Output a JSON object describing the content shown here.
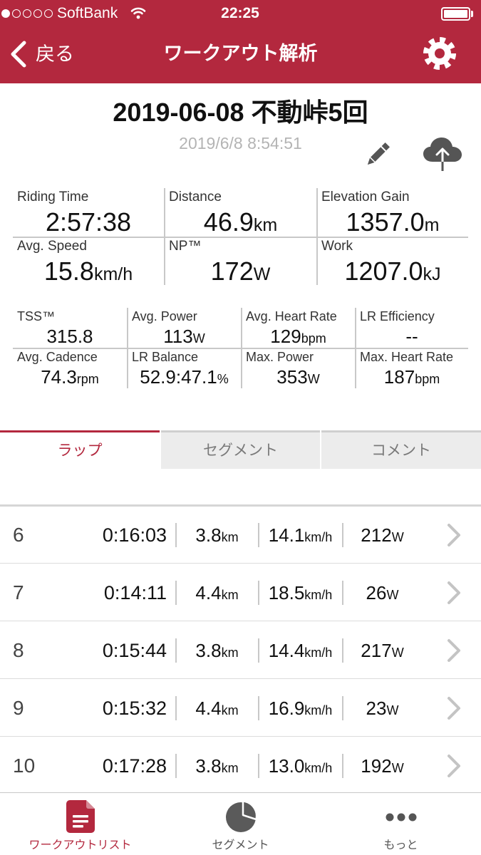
{
  "colors": {
    "accent": "#b3283e",
    "inactive_tab_bg": "#ececec",
    "muted_text": "#b4b4b4"
  },
  "status_bar": {
    "signal_level": 1,
    "signal_max": 5,
    "carrier": "SoftBank",
    "wifi_icon": "wifi-icon",
    "time": "22:25",
    "battery_icon": "battery-icon",
    "battery_level": 1.0
  },
  "nav": {
    "back_icon": "chevron-left-icon",
    "back_label": "戻る",
    "title": "ワークアウト解析",
    "settings_icon": "gear-icon"
  },
  "workout": {
    "title": "2019-06-08 不動峠5回",
    "datetime": "2019/6/8 8:54:51",
    "edit_icon": "pencil-icon",
    "upload_icon": "cloud-upload-icon"
  },
  "summary": [
    {
      "label": "Riding Time",
      "value": "2:57:38"
    },
    {
      "label": "Distance",
      "value": "46.9",
      "unit": "km"
    },
    {
      "label": "Elevation Gain",
      "value": "1357.0",
      "unit": "m"
    },
    {
      "label": "Avg. Speed",
      "value": "15.8",
      "unit": "km/h"
    },
    {
      "label": "NP™",
      "value": "172",
      "unit": "W"
    },
    {
      "label": "Work",
      "value": "1207.0",
      "unit": "kJ"
    }
  ],
  "metrics": [
    {
      "label": "TSS™",
      "value": "315.8"
    },
    {
      "label": "Avg. Power",
      "value": "113",
      "unit": "W"
    },
    {
      "label": "Avg. Heart Rate",
      "value": "129",
      "unit": "bpm"
    },
    {
      "label": "LR Efficiency",
      "value": "--"
    },
    {
      "label": "Avg. Cadence",
      "value": "74.3",
      "unit": "rpm"
    },
    {
      "label": "LR Balance",
      "value": "52.9:47.1",
      "unit": "%"
    },
    {
      "label": "Max. Power",
      "value": "353",
      "unit": "W"
    },
    {
      "label": "Max. Heart Rate",
      "value": "187",
      "unit": "bpm"
    }
  ],
  "tabs": [
    {
      "label": "ラップ",
      "active": true
    },
    {
      "label": "セグメント",
      "active": false
    },
    {
      "label": "コメント",
      "active": false
    }
  ],
  "laps": [
    {
      "number": "6",
      "time": "0:16:03",
      "distance": "3.8",
      "distance_unit": "km",
      "speed": "14.1",
      "speed_unit": "km/h",
      "power": "212",
      "power_unit": "W"
    },
    {
      "number": "7",
      "time": "0:14:11",
      "distance": "4.4",
      "distance_unit": "km",
      "speed": "18.5",
      "speed_unit": "km/h",
      "power": "26",
      "power_unit": "W"
    },
    {
      "number": "8",
      "time": "0:15:44",
      "distance": "3.8",
      "distance_unit": "km",
      "speed": "14.4",
      "speed_unit": "km/h",
      "power": "217",
      "power_unit": "W"
    },
    {
      "number": "9",
      "time": "0:15:32",
      "distance": "4.4",
      "distance_unit": "km",
      "speed": "16.9",
      "speed_unit": "km/h",
      "power": "23",
      "power_unit": "W"
    },
    {
      "number": "10",
      "time": "0:17:28",
      "distance": "3.8",
      "distance_unit": "km",
      "speed": "13.0",
      "speed_unit": "km/h",
      "power": "192",
      "power_unit": "W"
    }
  ],
  "lap_row_icon": "chevron-right-icon",
  "tab_bar": [
    {
      "label": "ワークアウトリスト",
      "icon": "document-icon",
      "active": true
    },
    {
      "label": "セグメント",
      "icon": "pie-chart-icon",
      "active": false
    },
    {
      "label": "もっと",
      "icon": "more-dots-icon",
      "active": false
    }
  ]
}
